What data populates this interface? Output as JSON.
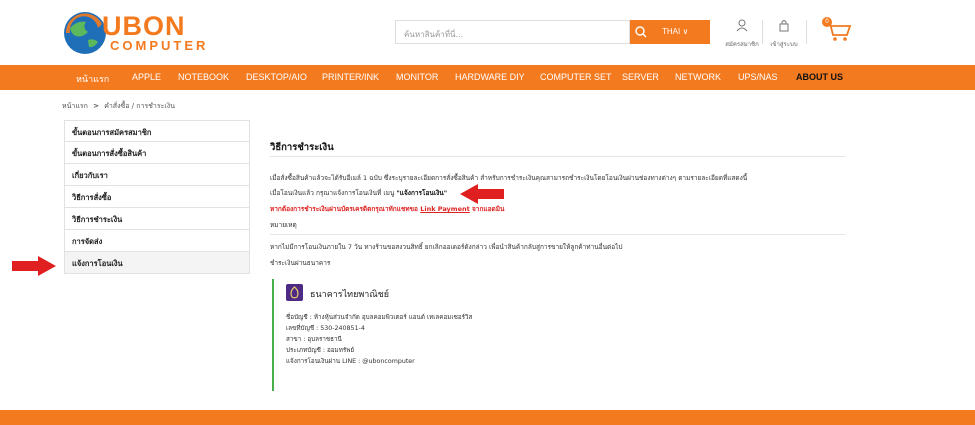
{
  "brand": {
    "logo_text": "UBON",
    "logo_sub": "COMPUTER",
    "primary_color": "#f47a20",
    "accent_green": "#49b049",
    "bank_color": "#4e2a84",
    "arrow_color": "#e02020"
  },
  "header": {
    "search_placeholder": "ค้นหาสินค้าที่นี่...",
    "lang_label": "THAI ∨",
    "register_label": "สมัครสมาชิก",
    "login_label": "เข้าสู่ระบบ",
    "cart_count": "0"
  },
  "nav": {
    "items": [
      "หน้าแรก",
      "APPLE",
      "NOTEBOOK",
      "DESKTOP/AIO",
      "PRINTER/INK",
      "MONITOR",
      "HARDWARE DIY",
      "COMPUTER SET",
      "SERVER",
      "NETWORK",
      "UPS/NAS",
      "ABOUT US"
    ]
  },
  "breadcrumb": {
    "home": "หน้าแรก",
    "separator": ">",
    "rest": "คำสั่งซื้อ / การชำระเงิน"
  },
  "sidebar": {
    "items": [
      "ขั้นตอนการสมัครสมาชิก",
      "ขั้นตอนการสั่งซื้อสินค้า",
      "เกี่ยวกับเรา",
      "วิธีการสั่งซื้อ",
      "วิธีการชำระเงิน",
      "การจัดส่ง",
      "แจ้งการโอนเงิน"
    ]
  },
  "main": {
    "title": "วิธีการชำระเงิน",
    "line1": "เมื่อสั่งซื้อสินค้าแล้วจะได้รับอีเมล์ 1 ฉบับ ซึ่งระบุรายละเอียดการสั่งซื้อสินค้า สำหรับการชำระเงินคุณสามารถชำระเงินโดยโอนเงินผ่านช่องทางต่างๆ ตามรายละเอียดที่แสดงนี้",
    "line2_prefix": "เมื่อโอนเงินแล้ว กรุณาแจ้งการโอนเงินที่ เมนู ",
    "line2_bold": "\"แจ้งการโอนเงิน\"",
    "line3_prefix": "หากต้องการชำระเงินผ่านบัตรเครดิตกรุณาทักแชทขอ ",
    "line3_link": "Link Payment",
    "line3_suffix": " จากแอดมิน",
    "note_label": "หมายเหตุ",
    "note_text": "หากไม่มีการโอนเงินภายใน 7 วัน ทางร้านขอสงวนสิทธิ์ ยกเลิกออเดอร์ดังกล่าว เพื่อนำสินค้ากลับสู่การขายให้ลูกค้าท่านอื่นต่อไป",
    "bank_heading": "ชำระเงินผ่านธนาคาร"
  },
  "bank": {
    "name": "ธนาคารไทยพาณิชย์",
    "account_name": "ชื่อบัญชี : ห้างหุ้นส่วนจำกัด อุบลคอมพิวเตอร์ แอนด์ เทเลคอมเซอร์วิส",
    "account_no": "เลขที่บัญชี : 530-240851-4",
    "branch": "สาขา : อุบลราชธานี",
    "type": "ประเภทบัญชี : ออมทรัพย์",
    "line_notify": "แจ้งการโอนเงินผ่าน LINE : @uboncomputer"
  }
}
